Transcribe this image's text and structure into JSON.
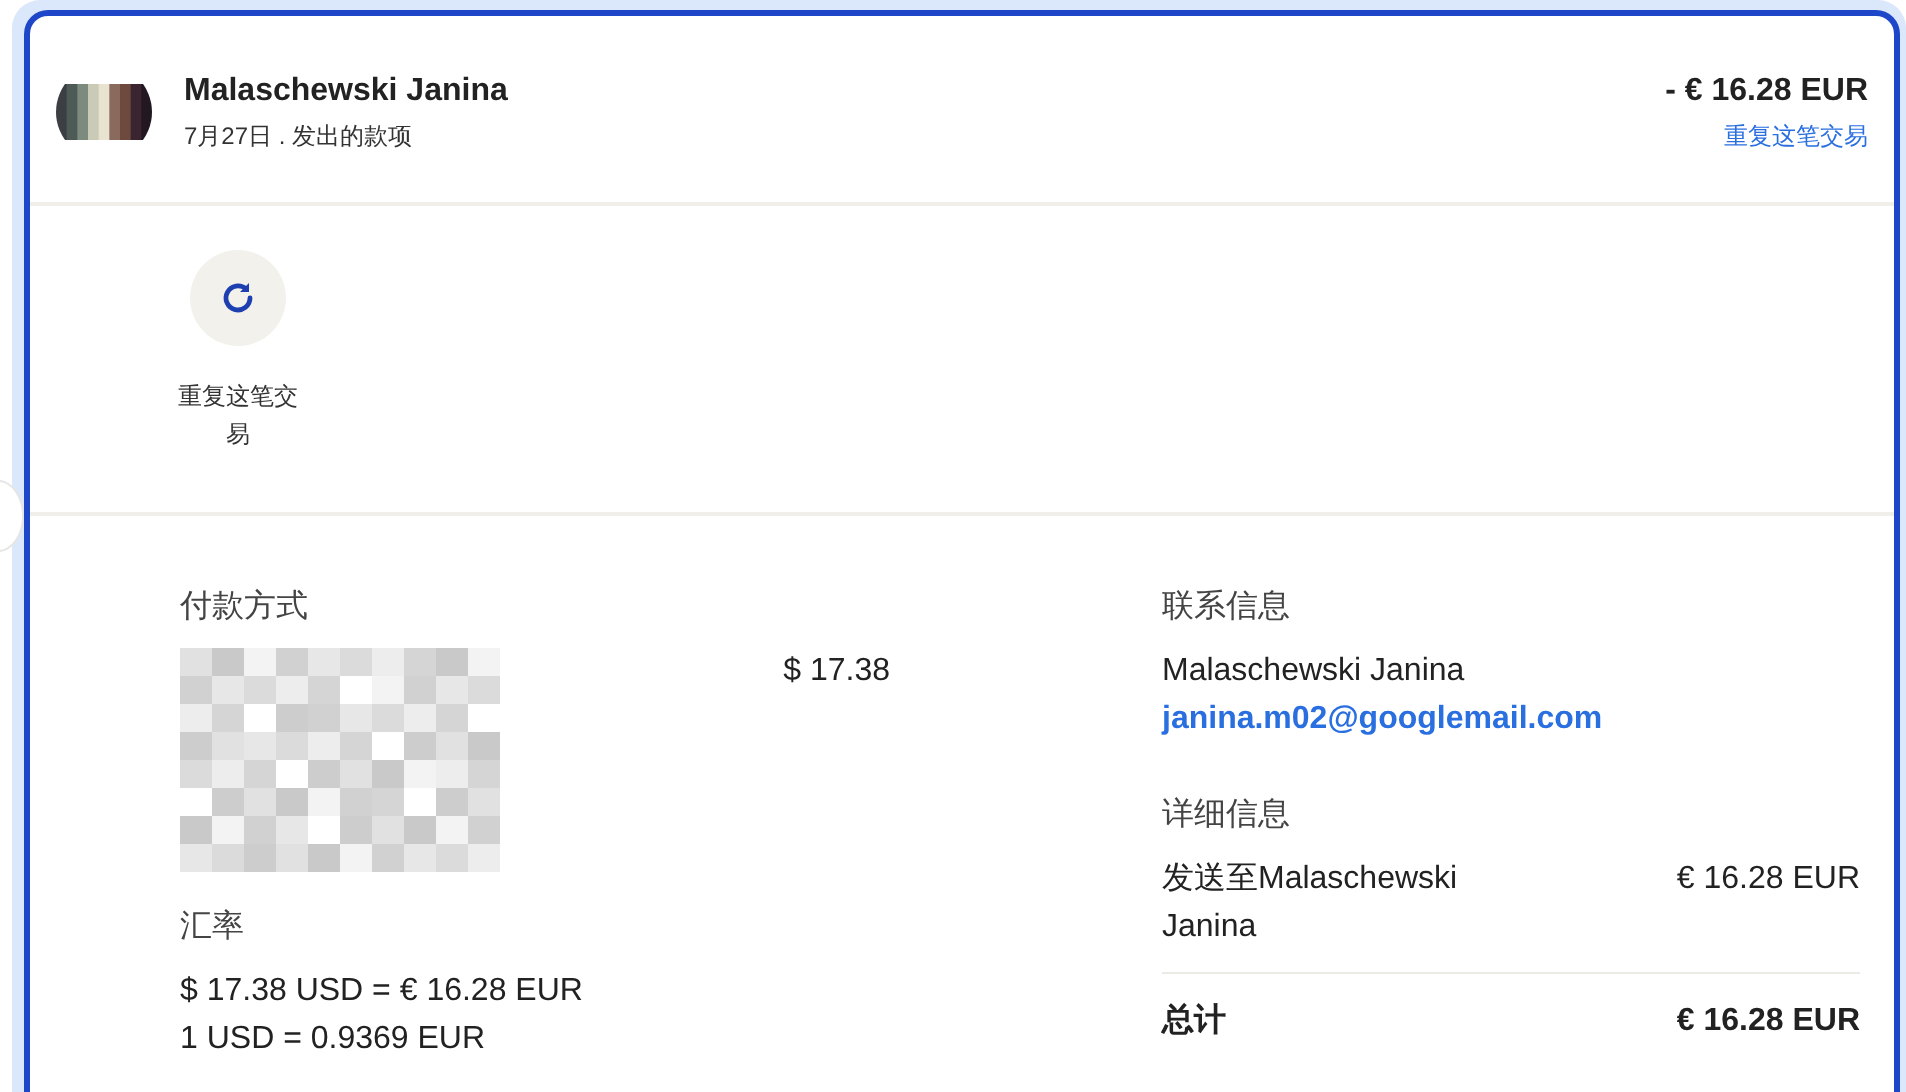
{
  "header": {
    "name": "Malaschewski Janina",
    "subtitle": "7月27日 . 发出的款项",
    "amount": "- € 16.28 EUR",
    "repeat_link": "重复这笔交易"
  },
  "actions": [
    {
      "label": "重复这笔交易"
    }
  ],
  "payment": {
    "heading": "付款方式",
    "amount": "$ 17.38"
  },
  "exchange": {
    "heading": "汇率",
    "lines": [
      "$ 17.38 USD = € 16.28 EUR",
      "1 USD = 0.9369 EUR"
    ]
  },
  "contact": {
    "heading": "联系信息",
    "name": "Malaschewski Janina",
    "email": "janina.m02@googlemail.com"
  },
  "details": {
    "heading": "详细信息",
    "rows": [
      {
        "kind": "item",
        "label": "发送至Malaschewski Janina",
        "value": "€ 16.28 EUR"
      },
      {
        "kind": "total",
        "label": "总计",
        "value": "€ 16.28 EUR"
      }
    ]
  }
}
